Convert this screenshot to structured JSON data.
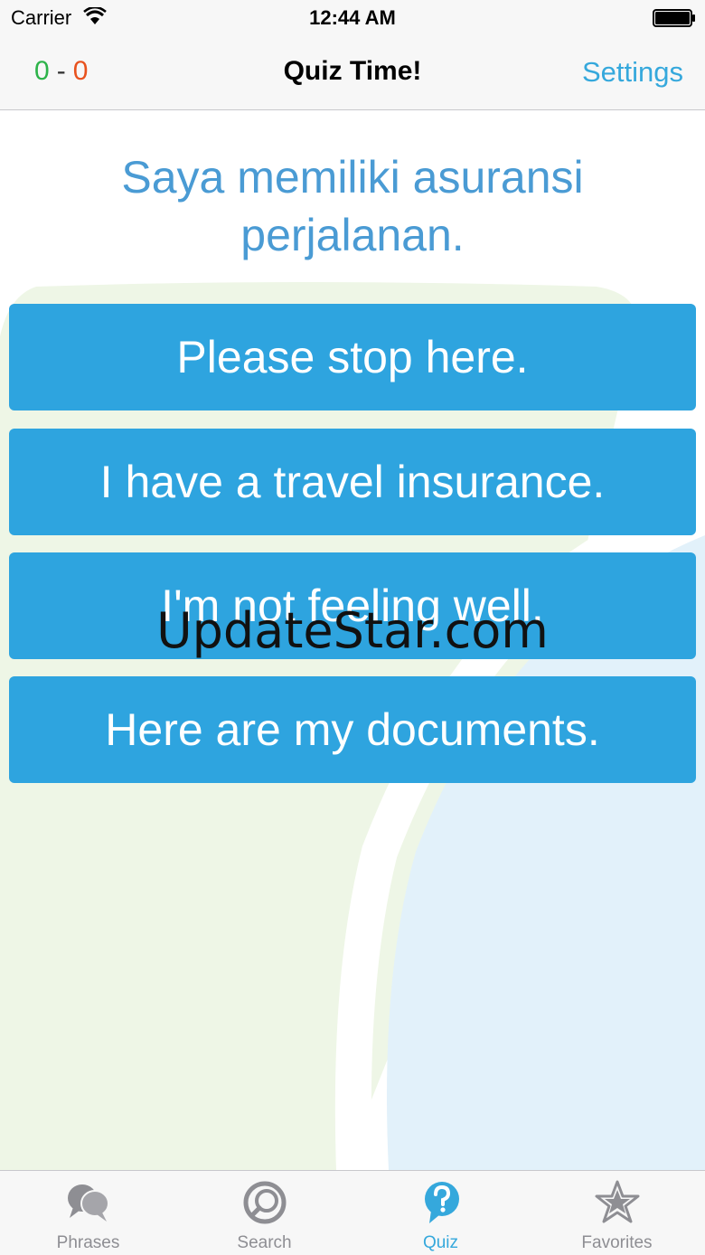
{
  "status_bar": {
    "carrier": "Carrier",
    "time": "12:44 AM"
  },
  "nav": {
    "score_correct": "0",
    "score_separator": "-",
    "score_wrong": "0",
    "title": "Quiz Time!",
    "settings_label": "Settings"
  },
  "quiz": {
    "question": "Saya memiliki asuransi perjalanan.",
    "answers": [
      "Please stop here.",
      "I have a travel insurance.",
      "I'm not feeling well.",
      "Here are my documents."
    ]
  },
  "watermark": "UpdateStar.com",
  "tab_bar": {
    "tabs": [
      {
        "label": "Phrases",
        "icon": "speech-bubbles-icon"
      },
      {
        "label": "Search",
        "icon": "magnifier-icon"
      },
      {
        "label": "Quiz",
        "icon": "question-bubble-icon"
      },
      {
        "label": "Favorites",
        "icon": "star-icon"
      }
    ],
    "active_tab": "Quiz"
  },
  "colors": {
    "accent": "#35a8dc",
    "answer_button": "#2ea4df",
    "question_text": "#4a9bd4",
    "score_correct": "#2db34a",
    "score_wrong": "#e8521e",
    "tab_inactive": "#8e8e93"
  }
}
